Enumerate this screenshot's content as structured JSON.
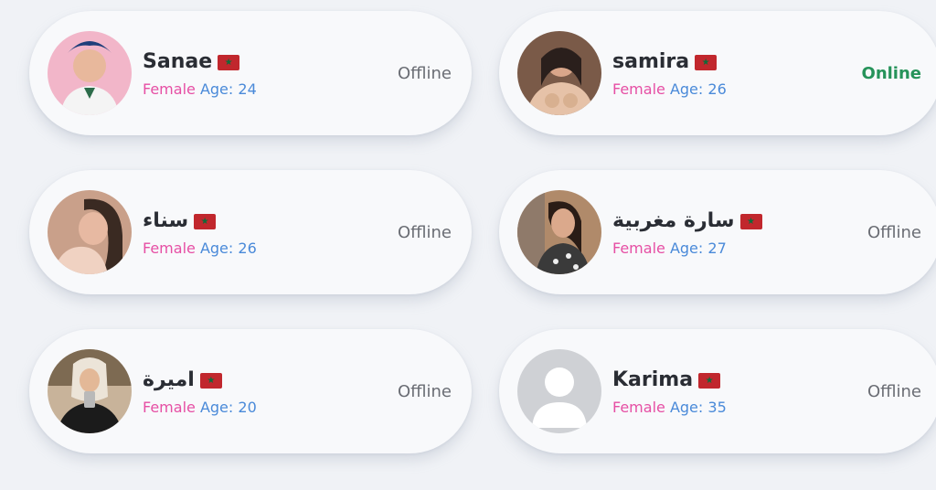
{
  "users": [
    {
      "name": "Sanae",
      "gender": "Female",
      "age_label": "Age:",
      "age": "24",
      "status": "Offline",
      "online": false,
      "avatar": "photo-avatar-icon",
      "flag": "morocco-flag-icon",
      "avatar_color": "#f2b6c9"
    },
    {
      "name": "samira",
      "gender": "Female",
      "age_label": "Age:",
      "age": "26",
      "status": "Online",
      "online": true,
      "avatar": "photo-avatar-icon",
      "flag": "morocco-flag-icon",
      "avatar_color": "#7a5a48"
    },
    {
      "name": "سناء",
      "gender": "Female",
      "age_label": "Age:",
      "age": "26",
      "status": "Offline",
      "online": false,
      "avatar": "photo-avatar-icon",
      "flag": "morocco-flag-icon",
      "avatar_color": "#c9a08a"
    },
    {
      "name": "سارة مغربية",
      "gender": "Female",
      "age_label": "Age:",
      "age": "27",
      "status": "Offline",
      "online": false,
      "avatar": "photo-avatar-icon",
      "flag": "morocco-flag-icon",
      "avatar_color": "#b08a6a"
    },
    {
      "name": "اميرة",
      "gender": "Female",
      "age_label": "Age:",
      "age": "20",
      "status": "Offline",
      "online": false,
      "avatar": "photo-avatar-icon",
      "flag": "morocco-flag-icon",
      "avatar_color": "#c8b39a"
    },
    {
      "name": "Karima",
      "gender": "Female",
      "age_label": "Age:",
      "age": "35",
      "status": "Offline",
      "online": false,
      "avatar": "default-user-avatar-icon",
      "flag": "morocco-flag-icon",
      "avatar_color": "#cfd1d5"
    }
  ],
  "colors": {
    "gender": "#e64fa4",
    "age": "#4a8ad9",
    "online": "#26935a",
    "offline": "#6a6d74",
    "flag_red": "#c1272d",
    "flag_star": "#0f6b3a"
  }
}
